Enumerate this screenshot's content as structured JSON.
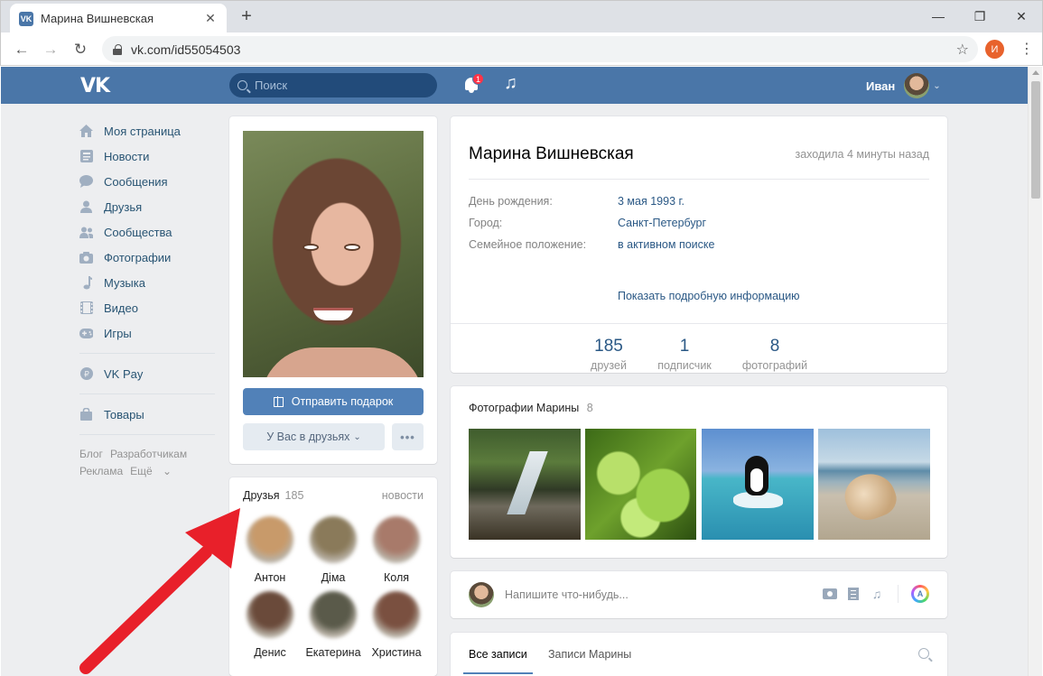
{
  "browser": {
    "tab_title": "Марина Вишневская",
    "tab_favicon": "VK",
    "url": "vk.com/id55054503",
    "profile_initial": "И"
  },
  "vk_header": {
    "logo": "VK",
    "search_placeholder": "Поиск",
    "notifications_count": "1",
    "user_name": "Иван"
  },
  "sidebar": {
    "items": [
      {
        "label": "Моя страница",
        "icon": "home-icon"
      },
      {
        "label": "Новости",
        "icon": "news-icon"
      },
      {
        "label": "Сообщения",
        "icon": "messages-icon"
      },
      {
        "label": "Друзья",
        "icon": "friend-icon"
      },
      {
        "label": "Сообщества",
        "icon": "groups-icon"
      },
      {
        "label": "Фотографии",
        "icon": "camera-icon"
      },
      {
        "label": "Музыка",
        "icon": "music-icon"
      },
      {
        "label": "Видео",
        "icon": "video-icon"
      },
      {
        "label": "Игры",
        "icon": "gamepad-icon"
      }
    ],
    "vkpay": "VK Pay",
    "goods": "Товары",
    "footer": {
      "blog": "Блог",
      "developers": "Разработчикам",
      "ads": "Реклама",
      "more": "Ещё"
    }
  },
  "profile": {
    "send_gift": "Отправить подарок",
    "friends_status": "У Вас в друзьях",
    "more": "•••",
    "name": "Марина Вишневская",
    "online": "заходила 4 минуты назад",
    "fields": [
      {
        "label": "День рождения:",
        "value": "3 мая 1993 г."
      },
      {
        "label": "Город:",
        "value": "Санкт-Петербург"
      },
      {
        "label": "Семейное положение:",
        "value": "в активном поиске"
      }
    ],
    "show_more": "Показать подробную информацию",
    "counters": [
      {
        "num": "185",
        "label": "друзей"
      },
      {
        "num": "1",
        "label": "подписчик"
      },
      {
        "num": "8",
        "label": "фотографий"
      }
    ]
  },
  "friends_block": {
    "title": "Друзья",
    "count": "185",
    "news_link": "новости",
    "friends": [
      {
        "name": "Антон",
        "color": "#c89a6a"
      },
      {
        "name": "Діма",
        "color": "#8a7a5a"
      },
      {
        "name": "Коля",
        "color": "#a87a6a"
      },
      {
        "name": "Денис",
        "color": "#6a4a3a"
      },
      {
        "name": "Екатерина",
        "color": "#5a5a4a"
      },
      {
        "name": "Христина",
        "color": "#7a5040"
      }
    ]
  },
  "photos_block": {
    "title": "Фотографии Марины",
    "count": "8"
  },
  "post_box": {
    "placeholder": "Напишите что-нибудь...",
    "a_icon_letter": "A"
  },
  "wall": {
    "tab_all": "Все записи",
    "tab_own": "Записи Марины"
  },
  "colors": {
    "vk_blue": "#4a76a8",
    "button_blue": "#5181b8",
    "link": "#2a5885",
    "annotation_arrow": "#e8202a"
  }
}
